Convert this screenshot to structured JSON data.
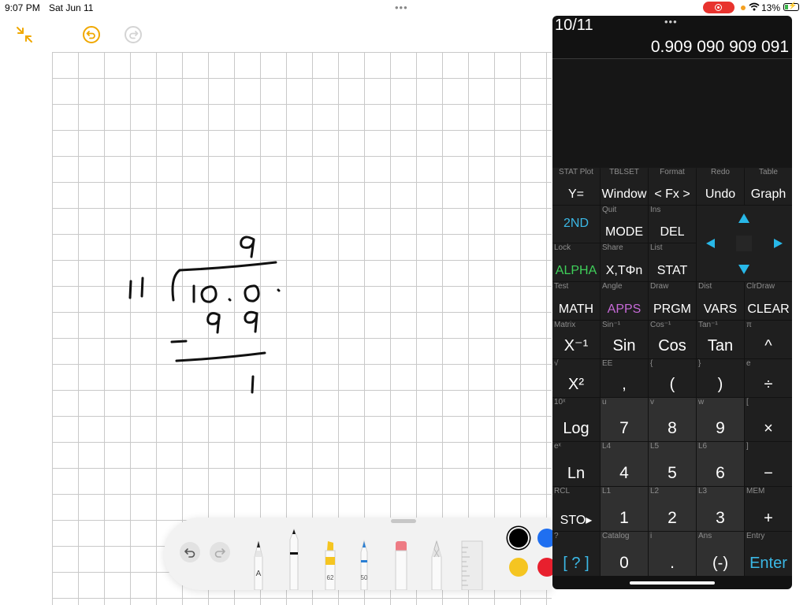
{
  "status_bar": {
    "time": "9:07 PM",
    "date": "Sat Jun 11",
    "battery": "13%",
    "more": "•••"
  },
  "notes": {
    "toolbar": {
      "collapse": "collapse-icon",
      "undo": "undo-icon",
      "redo": "redo-icon"
    },
    "palette": {
      "undo": "undo-icon",
      "redo": "redo-icon",
      "tools": [
        {
          "name": "pen",
          "label": "A",
          "color": "#222222"
        },
        {
          "name": "marker",
          "label": "",
          "color": "#111111"
        },
        {
          "name": "highlighter",
          "label": "62",
          "color": "#f5c521"
        },
        {
          "name": "fine-pen",
          "label": "50",
          "color": "#2a7fd4"
        },
        {
          "name": "eraser",
          "label": "",
          "color": "#ee7b84"
        },
        {
          "name": "pencil",
          "label": "",
          "color": "#d0d0d0"
        },
        {
          "name": "ruler",
          "label": "",
          "color": "#e4e4e4"
        }
      ],
      "colors": [
        "#000000",
        "#1f6ff0",
        "#f5c521",
        "#e8202e"
      ]
    }
  },
  "calculator": {
    "expression": "10/11",
    "result": "0.909 090 909 091",
    "menu": "•••",
    "rows": [
      [
        {
          "sub": "STAT Plot",
          "label": "Y="
        },
        {
          "sub": "TBLSET",
          "label": "Window"
        },
        {
          "sub": "Format",
          "label": "< Fx >"
        },
        {
          "sub": "Redo",
          "label": "Undo"
        },
        {
          "sub": "Table",
          "label": "Graph"
        }
      ],
      [
        {
          "sub": "",
          "label": "2ND"
        },
        {
          "sub": "Quit",
          "label": "MODE"
        },
        {
          "sub": "Ins",
          "label": "DEL"
        }
      ],
      [
        {
          "sub": "Lock",
          "label": "ALPHA"
        },
        {
          "sub": "Share",
          "label": "X,TΦn"
        },
        {
          "sub": "List",
          "label": "STAT"
        }
      ],
      [
        {
          "sub": "Test",
          "label": "MATH"
        },
        {
          "sub": "Angle",
          "label": "APPS"
        },
        {
          "sub": "Draw",
          "label": "PRGM"
        },
        {
          "sub": "Dist",
          "label": "VARS"
        },
        {
          "sub": "ClrDraw",
          "label": "CLEAR"
        }
      ],
      [
        {
          "sub": "Matrix",
          "label": "X⁻¹"
        },
        {
          "sub": "Sin⁻¹",
          "label": "Sin"
        },
        {
          "sub": "Cos⁻¹",
          "label": "Cos"
        },
        {
          "sub": "Tan⁻¹",
          "label": "Tan"
        },
        {
          "sub": "π",
          "label": "^"
        }
      ],
      [
        {
          "sub": "√",
          "label": "X²"
        },
        {
          "sub": "EE",
          "label": ","
        },
        {
          "sub": "{",
          "label": "("
        },
        {
          "sub": "}",
          "label": ")"
        },
        {
          "sub": "e",
          "label": "÷"
        }
      ],
      [
        {
          "sub": "10ˣ",
          "label": "Log"
        },
        {
          "sub": "u",
          "label": "7"
        },
        {
          "sub": "v",
          "label": "8"
        },
        {
          "sub": "w",
          "label": "9"
        },
        {
          "sub": "[",
          "label": "×"
        }
      ],
      [
        {
          "sub": "eˣ",
          "label": "Ln"
        },
        {
          "sub": "L4",
          "label": "4"
        },
        {
          "sub": "L5",
          "label": "5"
        },
        {
          "sub": "L6",
          "label": "6"
        },
        {
          "sub": "]",
          "label": "−"
        }
      ],
      [
        {
          "sub": "RCL",
          "label": "STO▸"
        },
        {
          "sub": "L1",
          "label": "1"
        },
        {
          "sub": "L2",
          "label": "2"
        },
        {
          "sub": "L3",
          "label": "3"
        },
        {
          "sub": "MEM",
          "label": "+"
        }
      ],
      [
        {
          "sub": "?",
          "label": "[ ? ]"
        },
        {
          "sub": "Catalog",
          "label": "0"
        },
        {
          "sub": "i",
          "label": "."
        },
        {
          "sub": "Ans",
          "label": "(-)"
        },
        {
          "sub": "Entry",
          "label": "Enter"
        }
      ]
    ],
    "colors": {
      "second": "#3bb8e6",
      "alpha": "#3fd05a",
      "apps": "#c76ad8",
      "arrow": "#28b8e8"
    }
  }
}
